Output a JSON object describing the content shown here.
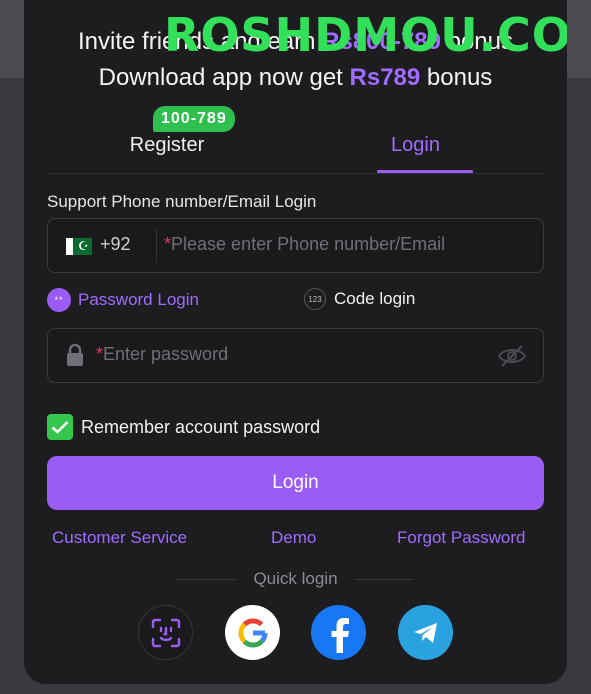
{
  "watermark": "ROSHDMOU.COM",
  "promo": {
    "line1_prefix": "Invite friends and earn ",
    "line1_amount": "Rs800-789",
    "line1_suffix": " bonus",
    "line2_prefix": "Download app now get ",
    "line2_amount": "Rs789",
    "line2_suffix": " bonus"
  },
  "tabs": {
    "register": "Register",
    "register_badge": "100-789",
    "login": "Login",
    "active": "login"
  },
  "form": {
    "support_label": "Support Phone number/Email Login",
    "country_code": "+92",
    "required_mark": "*",
    "phone_placeholder": "Please enter Phone number/Email",
    "password_mode_label": "Password Login",
    "password_mode_icon": "**",
    "code_mode_label": "Code login",
    "code_mode_icon": "123",
    "password_placeholder": "Enter password",
    "remember_label": "Remember account password",
    "remember_checked": true,
    "login_button": "Login"
  },
  "links": {
    "customer_service": "Customer Service",
    "demo": "Demo",
    "forgot_password": "Forgot Password"
  },
  "quick_login": {
    "label": "Quick login",
    "providers": [
      "face-id-icon",
      "google-icon",
      "facebook-icon",
      "telegram-icon"
    ]
  },
  "colors": {
    "accent": "#9a5cf5",
    "panel": "#1d1d20",
    "badge": "#2fbf4f",
    "checkbox": "#35c64e",
    "watermark": "#33e05a"
  }
}
